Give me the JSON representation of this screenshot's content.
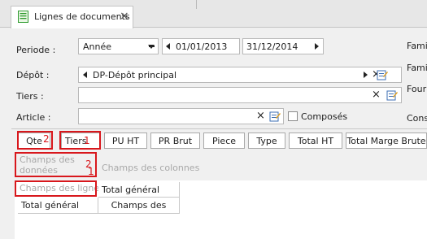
{
  "tab": {
    "title": "Lignes de documents",
    "close_glyph": "×",
    "icon": "document-icon"
  },
  "filters": {
    "periode": {
      "label": "Periode :",
      "type_value": "Année",
      "date_from": "01/01/2013",
      "date_to": "31/12/2014"
    },
    "depot": {
      "label": "Dépôt :",
      "value": "DP-Dépôt principal"
    },
    "tiers": {
      "label": "Tiers :",
      "value": ""
    },
    "article": {
      "label": "Article :",
      "value": "",
      "composes_label": "Composés",
      "composes_checked": false
    }
  },
  "right_labels": [
    "Famill",
    "Famill",
    "Fourn",
    "Const"
  ],
  "pivot": {
    "column_headers": [
      "Qte",
      "Tiers",
      "PU HT",
      "PR Brut",
      "Piece",
      "Type",
      "Total HT",
      "Total Marge Brute"
    ],
    "data_area_hint": "Champs des données",
    "column_area_hint": "Champs des colonnes",
    "row_area_hint": "Champs des lignes",
    "grand_total_col": "Total général",
    "grand_total_row": "Total général",
    "data_cell": "Champs des"
  },
  "annotations": [
    {
      "label": "1",
      "target": "Tiers"
    },
    {
      "label": "2",
      "target": "Qte"
    },
    {
      "label": "2",
      "target": "Champs des données"
    },
    {
      "label": "1",
      "target": "Champs des lignes"
    }
  ],
  "colors": {
    "annotation_red": "#d8171c",
    "ghost_text": "#a9a9a9",
    "tab_icon_green": "#2e9b2e"
  }
}
